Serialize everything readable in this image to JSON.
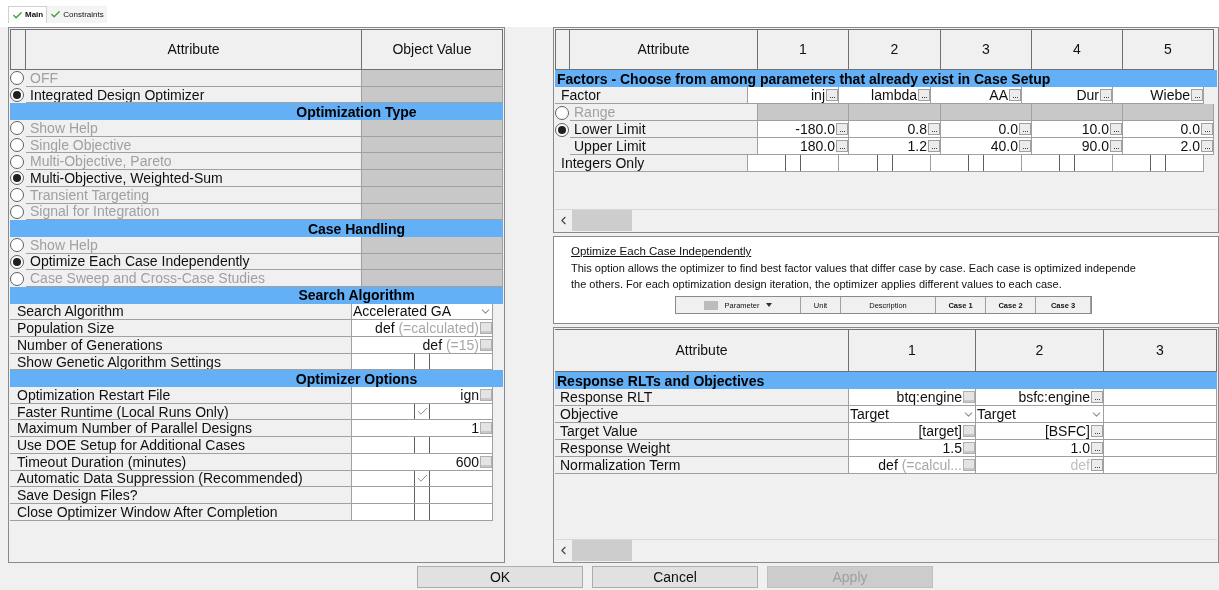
{
  "tabs": [
    {
      "label": "Main",
      "selected": true
    },
    {
      "label": "Constraints",
      "selected": false
    }
  ],
  "main_table": {
    "columns": [
      {
        "label": "Attribute"
      },
      {
        "label": "Object Value",
        "button": {
          "kind": "box"
        }
      }
    ],
    "rows": [
      {
        "kind": "option",
        "label": "OFF",
        "selected": false
      },
      {
        "kind": "option",
        "label": "Integrated Design Optimizer",
        "selected": true
      },
      {
        "kind": "section",
        "label": "Optimization Type"
      },
      {
        "kind": "option",
        "label": "Show Help",
        "selected": false
      },
      {
        "kind": "option",
        "label": "Single Objective",
        "selected": false
      },
      {
        "kind": "option",
        "label": "Multi-Objective, Pareto",
        "selected": false
      },
      {
        "kind": "option",
        "label": "Multi-Objective, Weighted-Sum",
        "selected": true
      },
      {
        "kind": "option",
        "label": "Transient Targeting",
        "selected": false
      },
      {
        "kind": "option",
        "label": "Signal for Integration",
        "selected": false
      },
      {
        "kind": "section",
        "label": "Case Handling"
      },
      {
        "kind": "option",
        "label": "Show Help",
        "selected": false
      },
      {
        "kind": "option",
        "label": "Optimize Each Case Independently",
        "selected": true
      },
      {
        "kind": "option",
        "label": "Case Sweep and Cross-Case Studies",
        "selected": false
      },
      {
        "kind": "section",
        "label": "Search Algorithm"
      },
      {
        "kind": "values",
        "label": "Search Algorithm",
        "cells": [
          {
            "kind": "dropdown",
            "value": "Accelerated GA"
          }
        ]
      },
      {
        "kind": "values",
        "label": "Population Size",
        "cells": [
          {
            "kind": "text",
            "value": "def",
            "hint": "(=calculated)"
          }
        ]
      },
      {
        "kind": "values",
        "label": "Number of Generations",
        "cells": [
          {
            "kind": "text",
            "value": "def",
            "hint": "(=15)"
          }
        ]
      },
      {
        "kind": "values",
        "label": "Show Genetic Algorithm Settings",
        "cells": [
          {
            "kind": "checkbox",
            "checked": false
          }
        ]
      },
      {
        "kind": "section",
        "label": "Optimizer Options"
      },
      {
        "kind": "values",
        "label": "Optimization Restart File",
        "cells": [
          {
            "kind": "text",
            "value": "ign"
          }
        ]
      },
      {
        "kind": "values",
        "label": "Faster Runtime (Local Runs Only)",
        "cells": [
          {
            "kind": "checkbox",
            "checked": true
          }
        ]
      },
      {
        "kind": "values",
        "label": "Maximum Number of Parallel Designs",
        "cells": [
          {
            "kind": "text",
            "value": "1"
          }
        ]
      },
      {
        "kind": "values",
        "label": "Use DOE Setup for Additional Cases",
        "cells": [
          {
            "kind": "checkbox",
            "checked": false
          }
        ]
      },
      {
        "kind": "values",
        "label": "Timeout Duration (minutes)",
        "cells": [
          {
            "kind": "text",
            "value": "600"
          }
        ]
      },
      {
        "kind": "values",
        "label": "Automatic Data Suppression (Recommended)",
        "cells": [
          {
            "kind": "checkbox",
            "checked": true
          }
        ]
      },
      {
        "kind": "values",
        "label": "Save Design Files?",
        "cells": [
          {
            "kind": "checkbox",
            "checked": false
          }
        ]
      },
      {
        "kind": "values",
        "label": "Close Optimizer Window After Completion",
        "cells": [
          {
            "kind": "checkbox",
            "checked": false
          }
        ]
      }
    ]
  },
  "factors_table": {
    "columns": [
      {
        "label": "Attribute"
      },
      {
        "label": "1",
        "button": {
          "kind": "ellipsis"
        }
      },
      {
        "label": "2",
        "button": {
          "kind": "ellipsis"
        }
      },
      {
        "label": "3",
        "button": {
          "kind": "ellipsis"
        }
      },
      {
        "label": "4",
        "button": {
          "kind": "ellipsis"
        }
      },
      {
        "label": "5",
        "button": {
          "kind": "ellipsis"
        }
      }
    ],
    "rows": [
      {
        "kind": "section",
        "label": "Factors - Choose from among parameters that already exist in Case Setup"
      },
      {
        "kind": "values",
        "label": "Factor",
        "cells": [
          {
            "kind": "text",
            "value": "inj"
          },
          {
            "kind": "text",
            "value": "lambda"
          },
          {
            "kind": "text",
            "value": "AA"
          },
          {
            "kind": "text",
            "value": "Dur"
          },
          {
            "kind": "text",
            "value": "Wiebe"
          }
        ]
      },
      {
        "kind": "option",
        "label": "Range",
        "selected": false
      },
      {
        "kind": "option",
        "label": "Lower Limit",
        "selected": true,
        "cells": [
          {
            "kind": "text",
            "value": "-180.0"
          },
          {
            "kind": "text",
            "value": "0.8"
          },
          {
            "kind": "text",
            "value": "0.0"
          },
          {
            "kind": "text",
            "value": "10.0"
          },
          {
            "kind": "text",
            "value": "0.0"
          }
        ]
      },
      {
        "kind": "sub",
        "label": "Upper Limit",
        "cells": [
          {
            "kind": "text",
            "value": "180.0"
          },
          {
            "kind": "text",
            "value": "1.2"
          },
          {
            "kind": "text",
            "value": "40.0"
          },
          {
            "kind": "text",
            "value": "90.0"
          },
          {
            "kind": "text",
            "value": "2.0"
          }
        ]
      },
      {
        "kind": "values",
        "label": "Integers Only",
        "cells": [
          {
            "kind": "checkbox",
            "checked": false
          },
          {
            "kind": "checkbox",
            "checked": false
          },
          {
            "kind": "checkbox",
            "checked": false
          },
          {
            "kind": "checkbox",
            "checked": false
          },
          {
            "kind": "checkbox",
            "checked": false
          }
        ]
      }
    ]
  },
  "help_panel": {
    "title": "Optimize Each Case Independently",
    "lines": [
      "This option allows the optimizer to find best factor values that differ case by case.  Each case is optimized independe",
      "the others.  For each optimization design iteration, the optimizer applies different values  to each case."
    ],
    "figure": {
      "columns": [
        {
          "label": "Parameter",
          "kind": "dropdown",
          "bold": false
        },
        {
          "label": "Unit",
          "kind": "plain",
          "bold": false
        },
        {
          "label": "Description",
          "kind": "plain",
          "bold": false
        },
        {
          "label": "Case 1",
          "kind": "plain",
          "bold": true
        },
        {
          "label": "Case 2",
          "kind": "plain",
          "bold": true
        },
        {
          "label": "Case 3",
          "kind": "plain",
          "bold": true
        }
      ]
    }
  },
  "responses_table": {
    "columns": [
      {
        "label": "Attribute"
      },
      {
        "label": "1",
        "button": {
          "kind": "box"
        }
      },
      {
        "label": "2",
        "button": {
          "kind": "ellipsis"
        }
      },
      {
        "label": "3"
      }
    ],
    "rows": [
      {
        "kind": "section",
        "label": "Response RLTs and Objectives"
      },
      {
        "kind": "values",
        "label": "Response RLT",
        "cells": [
          {
            "kind": "text",
            "value": "btq:engine"
          },
          {
            "kind": "text",
            "value": "bsfc:engine"
          }
        ]
      },
      {
        "kind": "values",
        "label": "Objective",
        "cells": [
          {
            "kind": "dropdown",
            "value": "Target"
          },
          {
            "kind": "dropdown",
            "value": "Target"
          }
        ]
      },
      {
        "kind": "values",
        "label": "Target Value",
        "cells": [
          {
            "kind": "text",
            "value": "[target]"
          },
          {
            "kind": "text",
            "value": "[BSFC]"
          }
        ]
      },
      {
        "kind": "values",
        "label": "Response Weight",
        "cells": [
          {
            "kind": "text",
            "value": "1.5"
          },
          {
            "kind": "text",
            "value": "1.0"
          }
        ]
      },
      {
        "kind": "values",
        "label": "Normalization Term",
        "cells": [
          {
            "kind": "text",
            "value": "def",
            "hint": "(=calcul..."
          },
          {
            "kind": "text",
            "placeholder": "def"
          }
        ]
      }
    ]
  },
  "buttons": [
    {
      "label": "OK",
      "disabled": false
    },
    {
      "label": "Cancel",
      "disabled": false
    },
    {
      "label": "Apply",
      "disabled": true
    }
  ]
}
